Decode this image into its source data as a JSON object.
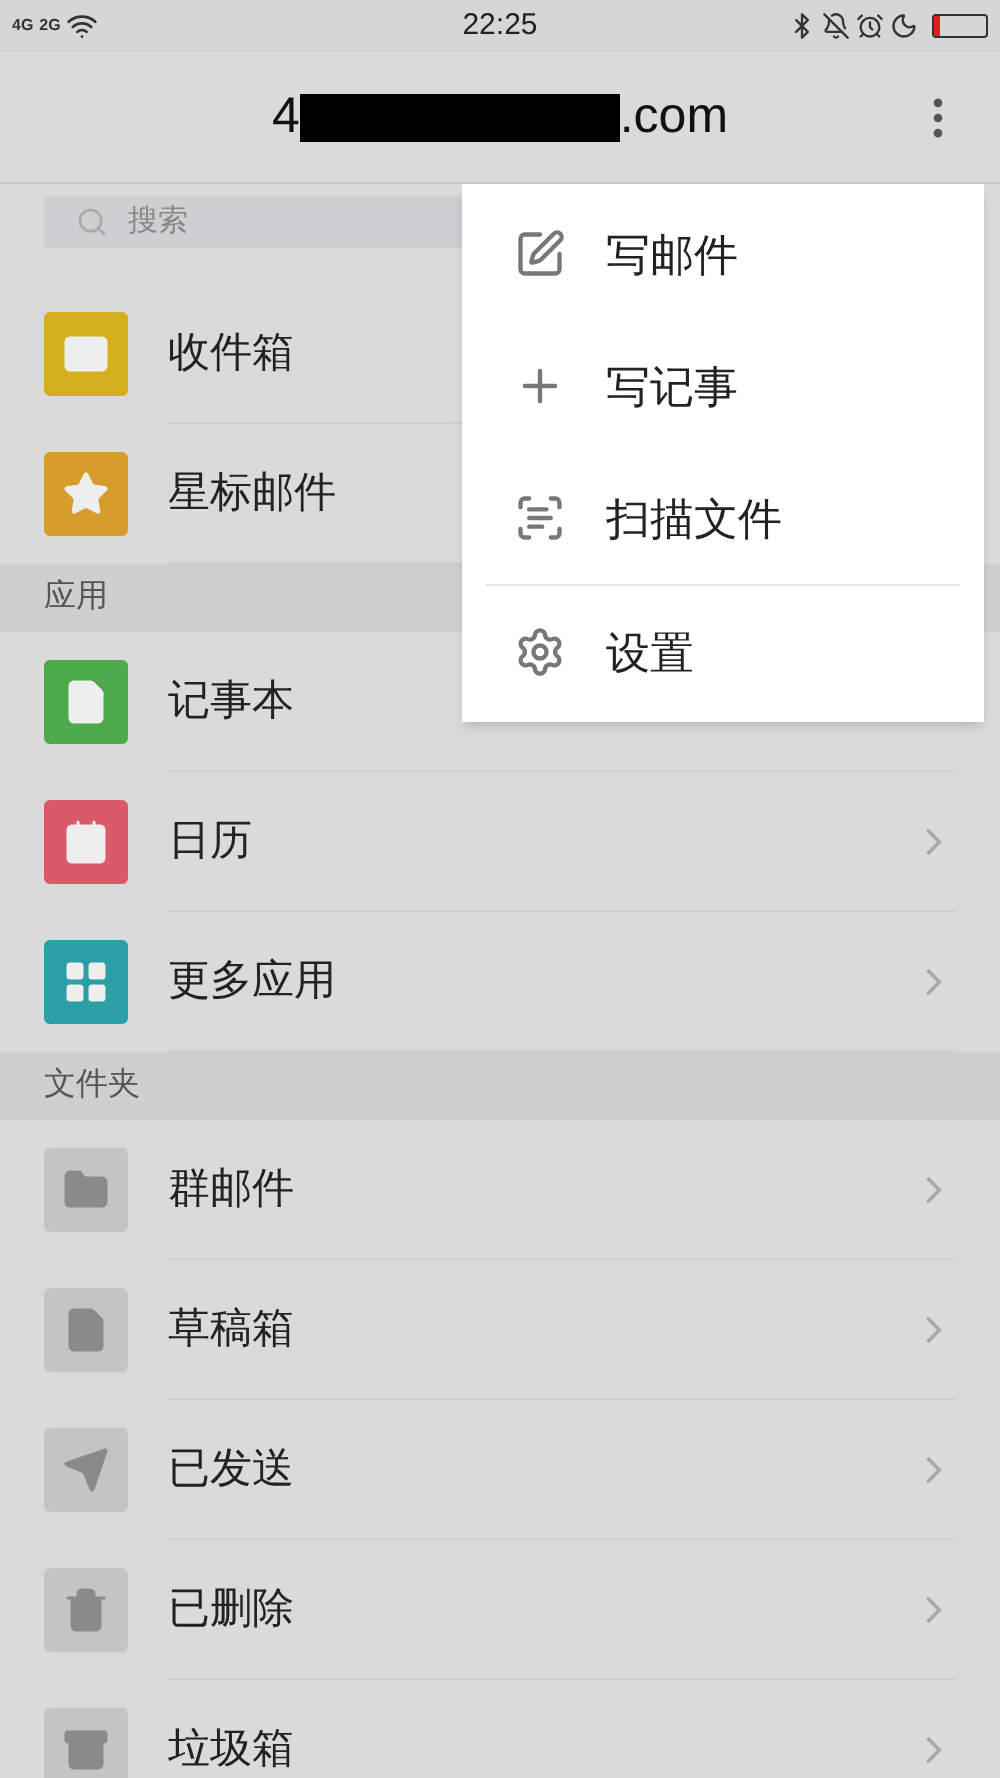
{
  "status_bar": {
    "signals": [
      "4G",
      "2G"
    ],
    "time": "22:25"
  },
  "header": {
    "title_start": "4",
    "title_end": ".com",
    "redacted": true
  },
  "search": {
    "placeholder": "搜索"
  },
  "sections": [
    {
      "items": [
        {
          "label": "收件箱",
          "kind": "mail",
          "color": "#d4b020",
          "chevron": false
        },
        {
          "label": "星标邮件",
          "kind": "star",
          "color": "#d89c2c",
          "chevron": false
        }
      ]
    },
    {
      "title": "应用",
      "items": [
        {
          "label": "记事本",
          "kind": "note",
          "color": "#4caa4a",
          "chevron": false
        },
        {
          "label": "日历",
          "kind": "calendar",
          "color": "#d95a68",
          "chevron": true
        },
        {
          "label": "更多应用",
          "kind": "apps",
          "color": "#2b9fa6",
          "chevron": true
        }
      ]
    },
    {
      "title": "文件夹",
      "items": [
        {
          "label": "群邮件",
          "kind": "folder",
          "color": "#c4c4c4",
          "chevron": true
        },
        {
          "label": "草稿箱",
          "kind": "draft",
          "color": "#c4c4c4",
          "chevron": true
        },
        {
          "label": "已发送",
          "kind": "send",
          "color": "#c4c4c4",
          "chevron": true
        },
        {
          "label": "已删除",
          "kind": "trash",
          "color": "#c4c4c4",
          "chevron": true
        },
        {
          "label": "垃圾箱",
          "kind": "spam",
          "color": "#c4c4c4",
          "chevron": true
        }
      ]
    }
  ],
  "menu": {
    "items": [
      {
        "label": "写邮件",
        "kind": "compose",
        "divider_before": false
      },
      {
        "label": "写记事",
        "kind": "plus",
        "divider_before": false
      },
      {
        "label": "扫描文件",
        "kind": "scan",
        "divider_before": false
      },
      {
        "label": "设置",
        "kind": "gear",
        "divider_before": true
      }
    ]
  }
}
